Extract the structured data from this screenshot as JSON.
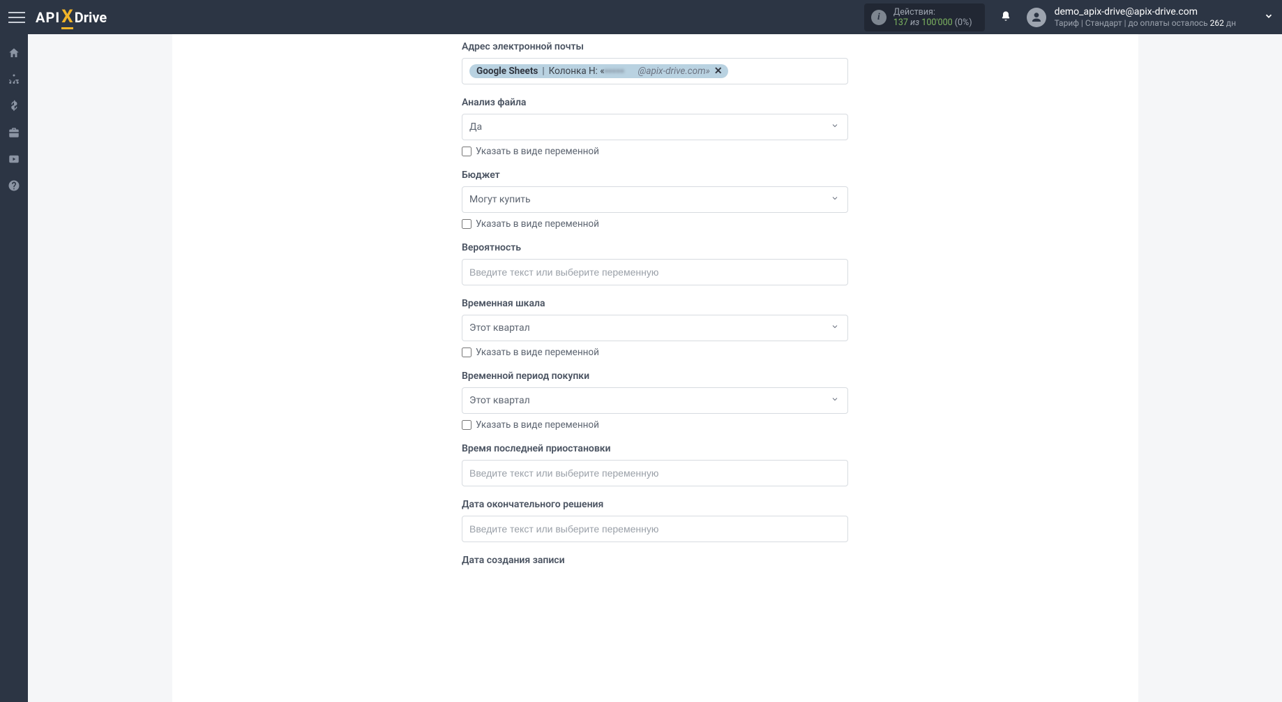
{
  "header": {
    "actions_label": "Действия:",
    "n137": "137",
    "iz": "из",
    "n100": "100'000",
    "pct": "(0%)",
    "email": "demo_apix-drive@apix-drive.com",
    "tariff_prefix": "Тариф | Стандарт | до оплаты осталось ",
    "tariff_days": "262",
    "tariff_suffix": " дн"
  },
  "fields": {
    "f0": {
      "label": "Адрес электронной почты",
      "chip_source": "Google Sheets",
      "chip_sep": " | ",
      "chip_col_prefix": "Колонка H: «",
      "chip_col_suffix": "@apix-drive.com»"
    },
    "f1": {
      "label": "Анализ файла",
      "value": "Да",
      "chk": "Указать в виде переменной"
    },
    "f2": {
      "label": "Бюджет",
      "value": "Могут купить",
      "chk": "Указать в виде переменной"
    },
    "f3": {
      "label": "Вероятность",
      "placeholder": "Введите текст или выберите переменную"
    },
    "f4": {
      "label": "Временная шкала",
      "value": "Этот квартал",
      "chk": "Указать в виде переменной"
    },
    "f5": {
      "label": "Временной период покупки",
      "value": "Этот квартал",
      "chk": "Указать в виде переменной"
    },
    "f6": {
      "label": "Время последней приостановки",
      "placeholder": "Введите текст или выберите переменную"
    },
    "f7": {
      "label": "Дата окончательного решения",
      "placeholder": "Введите текст или выберите переменную"
    },
    "f8": {
      "label": "Дата создания записи"
    }
  }
}
